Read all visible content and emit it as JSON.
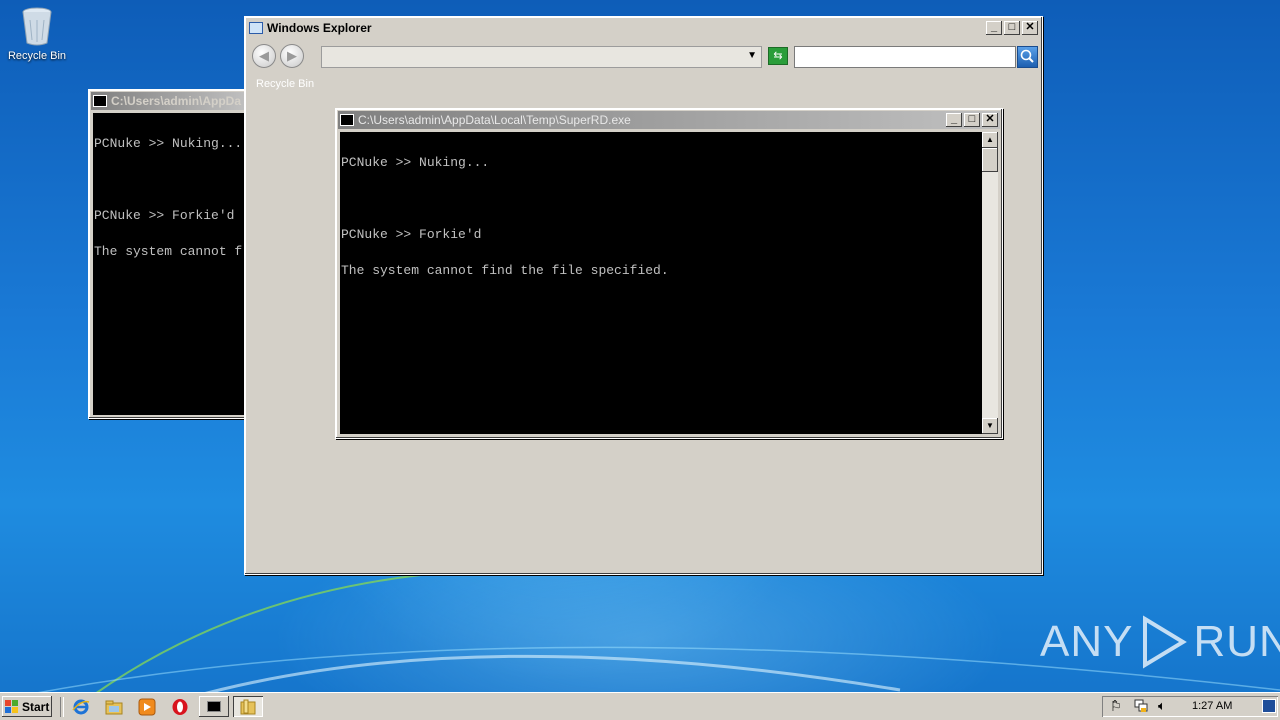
{
  "desktop": {
    "icons": [
      {
        "label": "Recycle Bin",
        "icon": "recycle-bin-icon"
      }
    ],
    "watermark": {
      "left": "ANY",
      "right": "RUN"
    }
  },
  "explorer": {
    "title": "Windows Explorer",
    "address_value": "",
    "search_value": "",
    "content_item": "Recycle Bin"
  },
  "console_back": {
    "title": "C:\\Users\\admin\\AppDa",
    "lines": [
      "PCNuke >> Nuking...",
      "",
      "PCNuke >> Forkie'd",
      "The system cannot f"
    ]
  },
  "console_front": {
    "title": "C:\\Users\\admin\\AppData\\Local\\Temp\\SuperRD.exe",
    "lines": [
      "PCNuke >> Nuking...",
      "",
      "PCNuke >> Forkie'd",
      "The system cannot find the file specified."
    ]
  },
  "taskbar": {
    "start_label": "Start",
    "clock": "1:27 AM"
  },
  "colors": {
    "title_active": "#0a246a",
    "console_bg": "#000000",
    "console_fg": "#c0c0c0",
    "taskbar": "#d4d0c8"
  }
}
